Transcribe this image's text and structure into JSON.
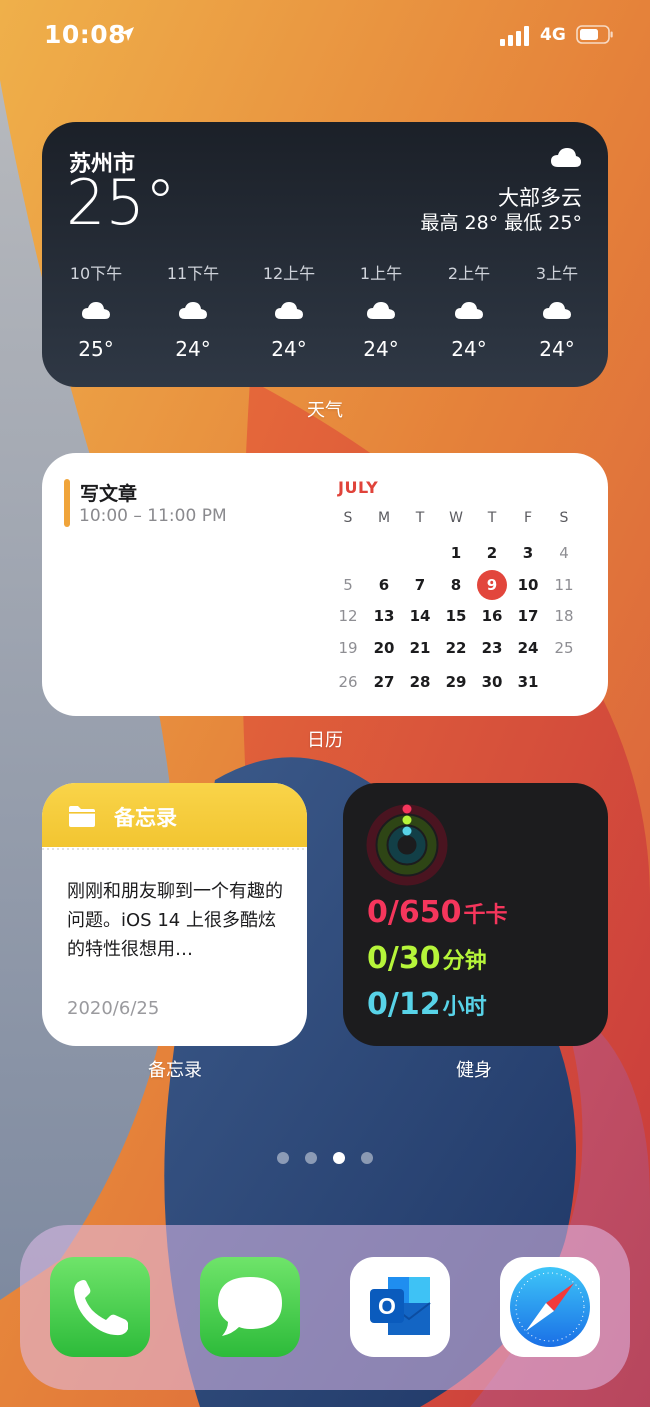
{
  "status": {
    "time": "10:08",
    "network": "4G"
  },
  "weather": {
    "city": "苏州市",
    "temp": "25°",
    "condition": "大部多云",
    "hilo": "最高 28° 最低 25°",
    "hours": [
      {
        "label": "10下午",
        "temp": "25°"
      },
      {
        "label": "11下午",
        "temp": "24°"
      },
      {
        "label": "12上午",
        "temp": "24°"
      },
      {
        "label": "1上午",
        "temp": "24°"
      },
      {
        "label": "2上午",
        "temp": "24°"
      },
      {
        "label": "3上午",
        "temp": "24°"
      }
    ],
    "caption": "天气"
  },
  "calendar": {
    "event_title": "写文章",
    "event_time": "10:00 – 11:00 PM",
    "month": "JULY",
    "weekdays": [
      "S",
      "M",
      "T",
      "W",
      "T",
      "F",
      "S"
    ],
    "weeks": [
      [
        "",
        "",
        "",
        "1",
        "2",
        "3",
        "4"
      ],
      [
        "5",
        "6",
        "7",
        "8",
        "9",
        "10",
        "11"
      ],
      [
        "12",
        "13",
        "14",
        "15",
        "16",
        "17",
        "18"
      ],
      [
        "19",
        "20",
        "21",
        "22",
        "23",
        "24",
        "25"
      ],
      [
        "26",
        "27",
        "28",
        "29",
        "30",
        "31",
        ""
      ]
    ],
    "today": "9",
    "caption": "日历"
  },
  "notes": {
    "title": "备忘录",
    "body": "刚刚和朋友聊到一个有趣的问题。iOS 14 上很多酷炫的特性很想用…",
    "date": "2020/6/25",
    "caption": "备忘录"
  },
  "fitness": {
    "move": {
      "value": "0/650",
      "unit": "千卡",
      "color": "#f5365c"
    },
    "exercise": {
      "value": "0/30",
      "unit": "分钟",
      "color": "#b6f53a"
    },
    "stand": {
      "value": "0/12",
      "unit": "小时",
      "color": "#58d3e8"
    },
    "caption": "健身"
  },
  "page_dots": {
    "count": 4,
    "active_index": 2
  },
  "dock": [
    {
      "name": "phone-icon"
    },
    {
      "name": "messages-icon"
    },
    {
      "name": "outlook-icon"
    },
    {
      "name": "safari-icon"
    }
  ]
}
